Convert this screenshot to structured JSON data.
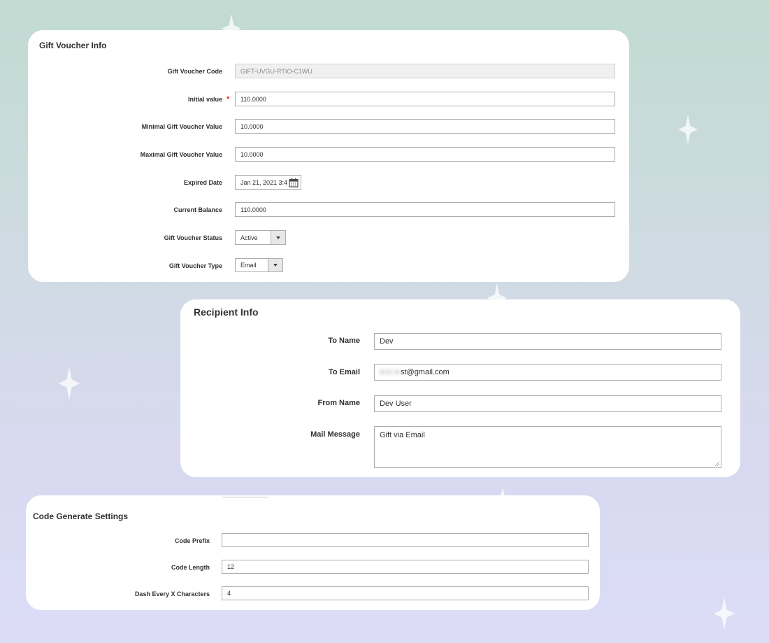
{
  "voucher": {
    "title": "Gift Voucher Info",
    "required_mark": "*",
    "fields": {
      "code_label": "Gift Voucher Code",
      "code_value": "GIFT-UVGU-RTIO-C1WU",
      "initial_label": "Initial value",
      "initial_value": "110.0000",
      "min_label": "Minimal Gift Voucher Value",
      "min_value": "10.0000",
      "max_label": "Maximal Gift Voucher Value",
      "max_value": "10.0000",
      "expired_label": "Expired Date",
      "expired_value": "Jan 21, 2021 3:4",
      "balance_label": "Current Balance",
      "balance_value": "110.0000",
      "status_label": "Gift Voucher Status",
      "status_value": "Active",
      "type_label": "Gift Voucher Type",
      "type_value": "Email"
    }
  },
  "recipient": {
    "title": "Recipient Info",
    "to_name_label": "To Name",
    "to_name_value": "Dev",
    "to_email_label": "To Email",
    "to_email_hidden": "test.te",
    "to_email_value": "st@gmail.com",
    "from_name_label": "From Name",
    "from_name_value": "Dev User",
    "message_label": "Mail Message",
    "message_value": "Gift via Email"
  },
  "codegen": {
    "title": "Code Generate Settings",
    "prefix_label": "Code Prefix",
    "prefix_value": "",
    "length_label": "Code Length",
    "length_value": "12",
    "dash_label": "Dash Every X Characters",
    "dash_value": "4"
  },
  "icons": {
    "calendar": "calendar-icon",
    "caret": "chevron-down-icon",
    "sparkle": "sparkle-icon"
  },
  "colors": {
    "required": "#e22626",
    "border": "#adadad",
    "disabled_bg": "#f0f0f0"
  }
}
